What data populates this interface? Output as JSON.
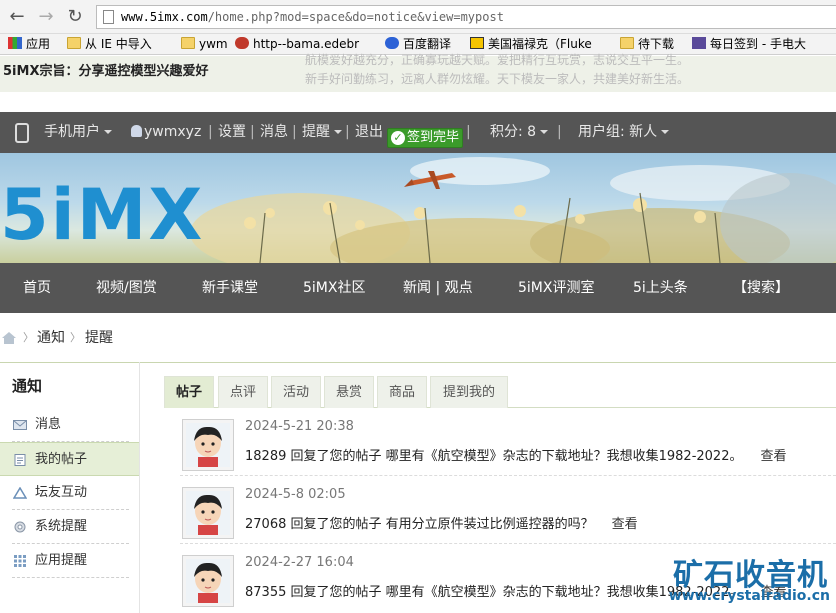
{
  "browser": {
    "url_host": "www.5imx.com",
    "url_path": "/home.php?mod=space&do=notice&view=mypost",
    "bookmarks": [
      "应用",
      "从 IE 中导入",
      "ywm",
      "http--bama.edebr",
      "百度翻译",
      "美国福禄克（Fluke",
      "待下载",
      "每日签到 - 手电大"
    ]
  },
  "site": {
    "slogan": "5iMX宗旨：分享遥控模型兴趣爱好",
    "ghost_line1": "航模爱好越充分，正确寡玩越天赋。爱把精行互玩赏，志说交互平一生。",
    "ghost_line2": "新手好问勤练习，远离人群勿炫耀。天下模友一家人，共建美好新生活。",
    "logo": "5iMX"
  },
  "userbar": {
    "mobile": "手机用户",
    "username": "ywmxyz",
    "settings": "设置",
    "messages": "消息",
    "remind": "提醒",
    "logout": "退出",
    "signed": "签到完毕",
    "points": "积分: 8",
    "group": "用户组: 新人"
  },
  "mainnav": [
    "首页",
    "视频/图赏",
    "新手课堂",
    "5iMX社区",
    "新闻 | 观点",
    "5iMX评测室",
    "5i上头条",
    "【搜索】"
  ],
  "breadcrumb": [
    "通知",
    "提醒"
  ],
  "sidebar": {
    "title": "通知",
    "items": [
      "消息",
      "我的帖子",
      "坛友互动",
      "系统提醒",
      "应用提醒"
    ]
  },
  "tabs": [
    "帖子",
    "点评",
    "活动",
    "悬赏",
    "商品",
    "提到我的"
  ],
  "notices": [
    {
      "time": "2024-5-21 20:38",
      "text": "18289 回复了您的帖子 哪里有《航空模型》杂志的下载地址？我想收集1982-2022。",
      "action": "查看"
    },
    {
      "time": "2024-5-8 02:05",
      "text": "27068 回复了您的帖子 有用分立原件装过比例遥控器的吗？",
      "action": "查看"
    },
    {
      "time": "2024-2-27 16:04",
      "text": "87355 回复了您的帖子 哪里有《航空模型》杂志的下载地址？我想收集1982-2022。",
      "action": "查看"
    }
  ],
  "watermark": {
    "cn": "矿石收音机",
    "url": "www.crystalradio.cn"
  },
  "colors": {
    "nav_bg": "#555555",
    "accent_green": "#3b9b2a",
    "logo_blue": "#1f8fd0",
    "active_tab": "#e3ecd3"
  }
}
